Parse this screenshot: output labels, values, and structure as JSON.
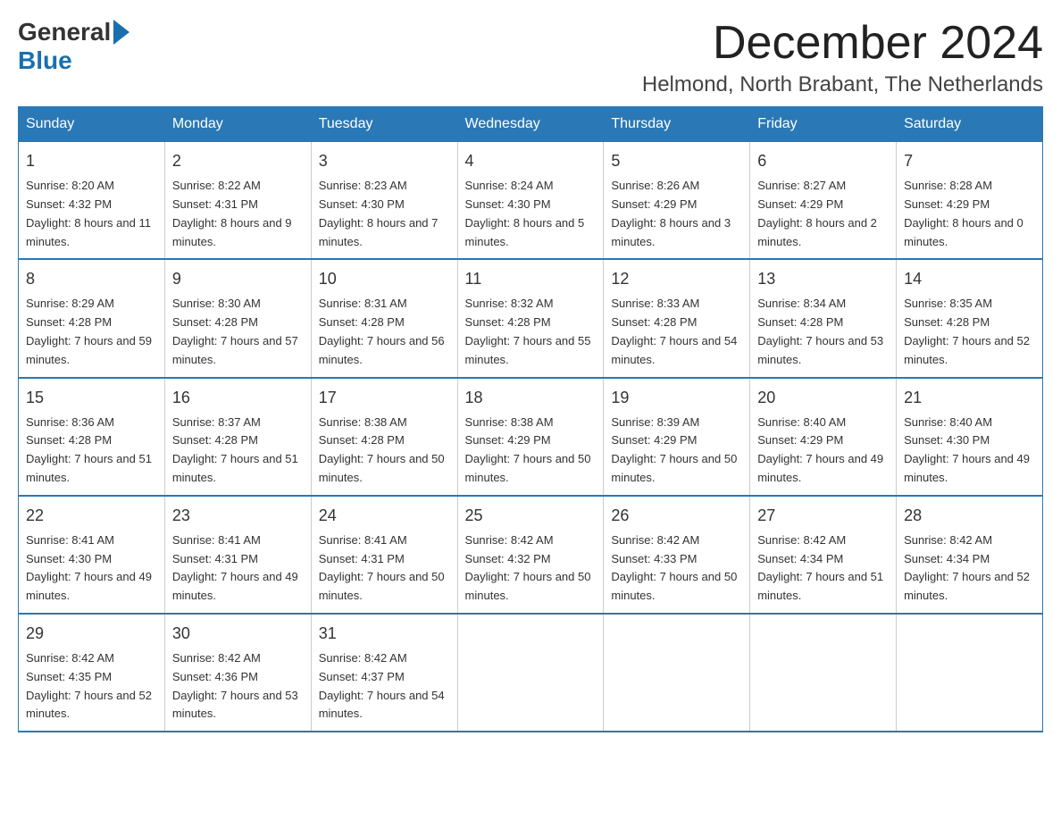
{
  "header": {
    "logo_general": "General",
    "logo_blue": "Blue",
    "month_title": "December 2024",
    "location": "Helmond, North Brabant, The Netherlands"
  },
  "weekdays": [
    "Sunday",
    "Monday",
    "Tuesday",
    "Wednesday",
    "Thursday",
    "Friday",
    "Saturday"
  ],
  "weeks": [
    [
      {
        "day": "1",
        "sunrise": "8:20 AM",
        "sunset": "4:32 PM",
        "daylight": "8 hours and 11 minutes"
      },
      {
        "day": "2",
        "sunrise": "8:22 AM",
        "sunset": "4:31 PM",
        "daylight": "8 hours and 9 minutes"
      },
      {
        "day": "3",
        "sunrise": "8:23 AM",
        "sunset": "4:30 PM",
        "daylight": "8 hours and 7 minutes"
      },
      {
        "day": "4",
        "sunrise": "8:24 AM",
        "sunset": "4:30 PM",
        "daylight": "8 hours and 5 minutes"
      },
      {
        "day": "5",
        "sunrise": "8:26 AM",
        "sunset": "4:29 PM",
        "daylight": "8 hours and 3 minutes"
      },
      {
        "day": "6",
        "sunrise": "8:27 AM",
        "sunset": "4:29 PM",
        "daylight": "8 hours and 2 minutes"
      },
      {
        "day": "7",
        "sunrise": "8:28 AM",
        "sunset": "4:29 PM",
        "daylight": "8 hours and 0 minutes"
      }
    ],
    [
      {
        "day": "8",
        "sunrise": "8:29 AM",
        "sunset": "4:28 PM",
        "daylight": "7 hours and 59 minutes"
      },
      {
        "day": "9",
        "sunrise": "8:30 AM",
        "sunset": "4:28 PM",
        "daylight": "7 hours and 57 minutes"
      },
      {
        "day": "10",
        "sunrise": "8:31 AM",
        "sunset": "4:28 PM",
        "daylight": "7 hours and 56 minutes"
      },
      {
        "day": "11",
        "sunrise": "8:32 AM",
        "sunset": "4:28 PM",
        "daylight": "7 hours and 55 minutes"
      },
      {
        "day": "12",
        "sunrise": "8:33 AM",
        "sunset": "4:28 PM",
        "daylight": "7 hours and 54 minutes"
      },
      {
        "day": "13",
        "sunrise": "8:34 AM",
        "sunset": "4:28 PM",
        "daylight": "7 hours and 53 minutes"
      },
      {
        "day": "14",
        "sunrise": "8:35 AM",
        "sunset": "4:28 PM",
        "daylight": "7 hours and 52 minutes"
      }
    ],
    [
      {
        "day": "15",
        "sunrise": "8:36 AM",
        "sunset": "4:28 PM",
        "daylight": "7 hours and 51 minutes"
      },
      {
        "day": "16",
        "sunrise": "8:37 AM",
        "sunset": "4:28 PM",
        "daylight": "7 hours and 51 minutes"
      },
      {
        "day": "17",
        "sunrise": "8:38 AM",
        "sunset": "4:28 PM",
        "daylight": "7 hours and 50 minutes"
      },
      {
        "day": "18",
        "sunrise": "8:38 AM",
        "sunset": "4:29 PM",
        "daylight": "7 hours and 50 minutes"
      },
      {
        "day": "19",
        "sunrise": "8:39 AM",
        "sunset": "4:29 PM",
        "daylight": "7 hours and 50 minutes"
      },
      {
        "day": "20",
        "sunrise": "8:40 AM",
        "sunset": "4:29 PM",
        "daylight": "7 hours and 49 minutes"
      },
      {
        "day": "21",
        "sunrise": "8:40 AM",
        "sunset": "4:30 PM",
        "daylight": "7 hours and 49 minutes"
      }
    ],
    [
      {
        "day": "22",
        "sunrise": "8:41 AM",
        "sunset": "4:30 PM",
        "daylight": "7 hours and 49 minutes"
      },
      {
        "day": "23",
        "sunrise": "8:41 AM",
        "sunset": "4:31 PM",
        "daylight": "7 hours and 49 minutes"
      },
      {
        "day": "24",
        "sunrise": "8:41 AM",
        "sunset": "4:31 PM",
        "daylight": "7 hours and 50 minutes"
      },
      {
        "day": "25",
        "sunrise": "8:42 AM",
        "sunset": "4:32 PM",
        "daylight": "7 hours and 50 minutes"
      },
      {
        "day": "26",
        "sunrise": "8:42 AM",
        "sunset": "4:33 PM",
        "daylight": "7 hours and 50 minutes"
      },
      {
        "day": "27",
        "sunrise": "8:42 AM",
        "sunset": "4:34 PM",
        "daylight": "7 hours and 51 minutes"
      },
      {
        "day": "28",
        "sunrise": "8:42 AM",
        "sunset": "4:34 PM",
        "daylight": "7 hours and 52 minutes"
      }
    ],
    [
      {
        "day": "29",
        "sunrise": "8:42 AM",
        "sunset": "4:35 PM",
        "daylight": "7 hours and 52 minutes"
      },
      {
        "day": "30",
        "sunrise": "8:42 AM",
        "sunset": "4:36 PM",
        "daylight": "7 hours and 53 minutes"
      },
      {
        "day": "31",
        "sunrise": "8:42 AM",
        "sunset": "4:37 PM",
        "daylight": "7 hours and 54 minutes"
      },
      null,
      null,
      null,
      null
    ]
  ],
  "labels": {
    "sunrise": "Sunrise:",
    "sunset": "Sunset:",
    "daylight": "Daylight:"
  }
}
